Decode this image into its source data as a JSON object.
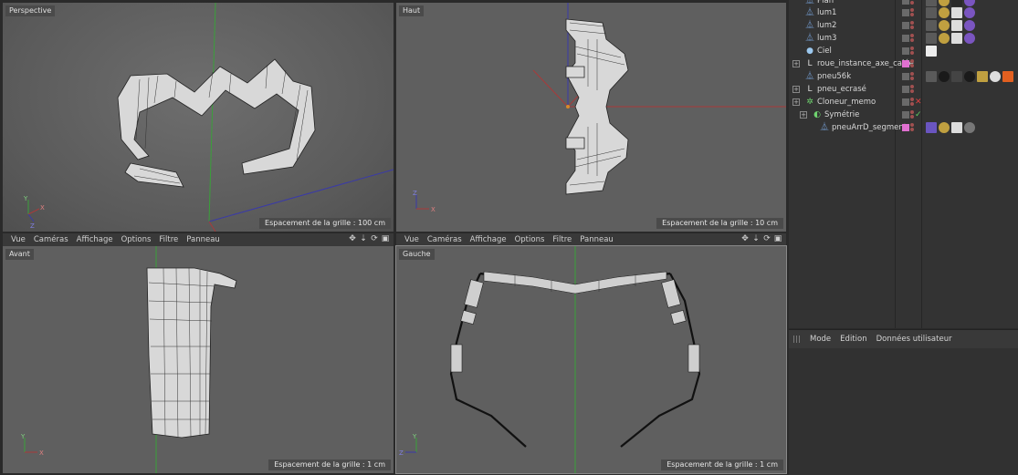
{
  "viewports": {
    "perspective": {
      "label": "Perspective",
      "grid": "Espacement de la grille : 100 cm"
    },
    "top": {
      "label": "Haut",
      "grid": "Espacement de la grille : 10 cm"
    },
    "front": {
      "label": "Avant",
      "grid": "Espacement de la grille : 1 cm"
    },
    "left": {
      "label": "Gauche",
      "grid": "Espacement de la grille : 1 cm"
    }
  },
  "viewport_menu": [
    "Vue",
    "Caméras",
    "Affichage",
    "Options",
    "Filtre",
    "Panneau"
  ],
  "object_manager": {
    "rows": [
      {
        "name": "Plan",
        "icon": "light-icon",
        "icon_color": "#7aa6e0",
        "indent": 0,
        "status": ""
      },
      {
        "name": "lum1",
        "icon": "light-icon",
        "icon_color": "#7aa6e0",
        "indent": 0,
        "status": ""
      },
      {
        "name": "lum2",
        "icon": "light-icon",
        "icon_color": "#7aa6e0",
        "indent": 0,
        "status": ""
      },
      {
        "name": "lum3",
        "icon": "light-icon",
        "icon_color": "#7aa6e0",
        "indent": 0,
        "status": ""
      },
      {
        "name": "Ciel",
        "icon": "sky-icon",
        "icon_color": "#9cc8ee",
        "indent": 0,
        "status": ""
      },
      {
        "name": "roue_instance_axe_calée",
        "icon": "instance-icon",
        "icon_color": "#dddddd",
        "indent": 0,
        "status": ""
      },
      {
        "name": "pneu56k",
        "icon": "polygon-object-icon",
        "icon_color": "#7aa6e0",
        "indent": 0,
        "status": ""
      },
      {
        "name": "pneu_ecrasé",
        "icon": "instance-icon",
        "icon_color": "#dddddd",
        "indent": 0,
        "status": ""
      },
      {
        "name": "Cloneur_memo",
        "icon": "cloner-icon",
        "icon_color": "#6fd36f",
        "indent": 0,
        "status": "✕"
      },
      {
        "name": "Symétrie",
        "icon": "symmetry-icon",
        "icon_color": "#6fd36f",
        "indent": 1,
        "status": "✓"
      },
      {
        "name": "pneuArrD_segment",
        "icon": "polygon-object-icon",
        "icon_color": "#7aa6e0",
        "indent": 2,
        "status": ""
      }
    ]
  },
  "attribute_manager": {
    "menu": [
      "Mode",
      "Edition",
      "Données utilisateur"
    ]
  }
}
